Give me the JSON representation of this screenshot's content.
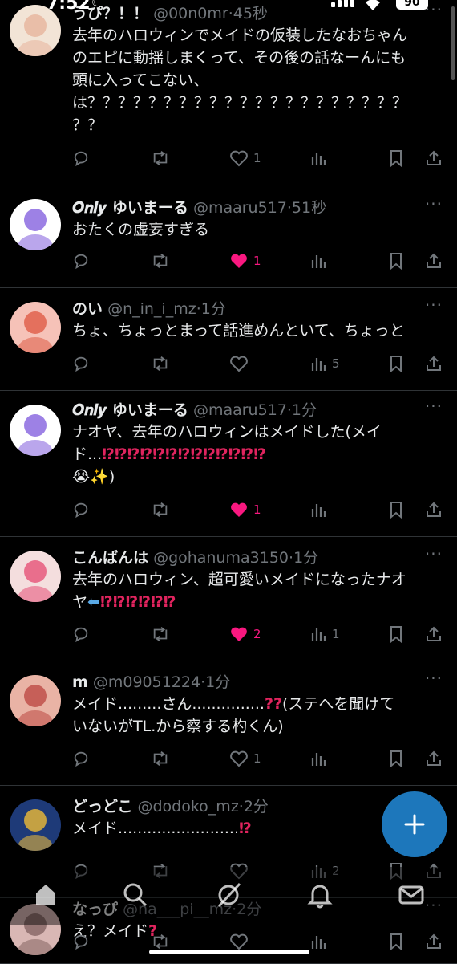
{
  "status_bar": {
    "time": "7:52",
    "battery": "90"
  },
  "tweets": [
    {
      "name": "うぴ？！！",
      "handle": "@00n0mr",
      "time": "45秒",
      "lines": [
        "去年のハロウィンでメイドの仮装したなおちゃん",
        "のエピに動揺しまくって、その後の話なーんにも",
        "頭に入ってこない、",
        "は？？？？？？？？？？？？？？？？？？？？？",
        "？？"
      ],
      "likes": "1",
      "views": "",
      "liked": false
    },
    {
      "name": "𝑶𝒏𝒍𝒚 ゆいまーる",
      "handle": "@maaru517",
      "time": "51秒",
      "lines": [
        "おたくの虚妄すぎる"
      ],
      "likes": "1",
      "views": "",
      "liked": true
    },
    {
      "name": "のい",
      "handle": "@n_in_i_mz",
      "time": "1分",
      "lines": [
        "ちょ、ちょっとまって話進めんといて、ちょっと"
      ],
      "likes": "",
      "views": "5",
      "liked": false
    },
    {
      "name": "𝑶𝒏𝒍𝒚 ゆいまーる",
      "handle": "@maaru517",
      "time": "1分",
      "lines": [
        "ナオヤ、去年のハロウィンはメイドした(メイ",
        "ド...⁉️⁉️⁉️⁉️⁉️⁉️⁉️⁉️⁉️⁉️⁉️⁉️⁉️",
        "😭✨)"
      ],
      "likes": "1",
      "views": "",
      "liked": true
    },
    {
      "name": "こんばんは",
      "handle": "@gohanuma3150",
      "time": "1分",
      "lines": [
        "去年のハロウィン、超可愛いメイドになったナオ",
        "ヤ⬅️⁉️⁉️⁉️⁉️⁉️⁉️"
      ],
      "likes": "2",
      "views": "1",
      "liked": true
    },
    {
      "name": "m",
      "handle": "@m09051224",
      "time": "1分",
      "lines": [
        "メイド.........さん...............❓❓(ステへを聞けて",
        "いないがTL.から察する杓くん)"
      ],
      "likes": "1",
      "views": "",
      "liked": false
    },
    {
      "name": "どっどこ",
      "handle": "@dodoko_mz",
      "time": "2分",
      "lines": [
        "メイド.........................⁉️"
      ],
      "likes": "",
      "views": "2",
      "liked": false
    },
    {
      "name": "なっぴ",
      "handle": "@na___pi__mz",
      "time": "2分",
      "lines": [
        "え？メイド❓"
      ],
      "likes": "",
      "views": "",
      "liked": false
    }
  ],
  "icons": {
    "reply": "reply-icon",
    "retweet": "retweet-icon",
    "like": "heart-icon",
    "views": "views-icon",
    "bookmark": "bookmark-icon",
    "share": "share-icon",
    "compose": "plus-icon"
  },
  "nav": [
    "home-icon",
    "search-icon",
    "grok-icon",
    "bell-icon",
    "mail-icon"
  ],
  "colors": {
    "like": "#f91880",
    "muted": "#71767b",
    "fab": "#1d77bb"
  }
}
